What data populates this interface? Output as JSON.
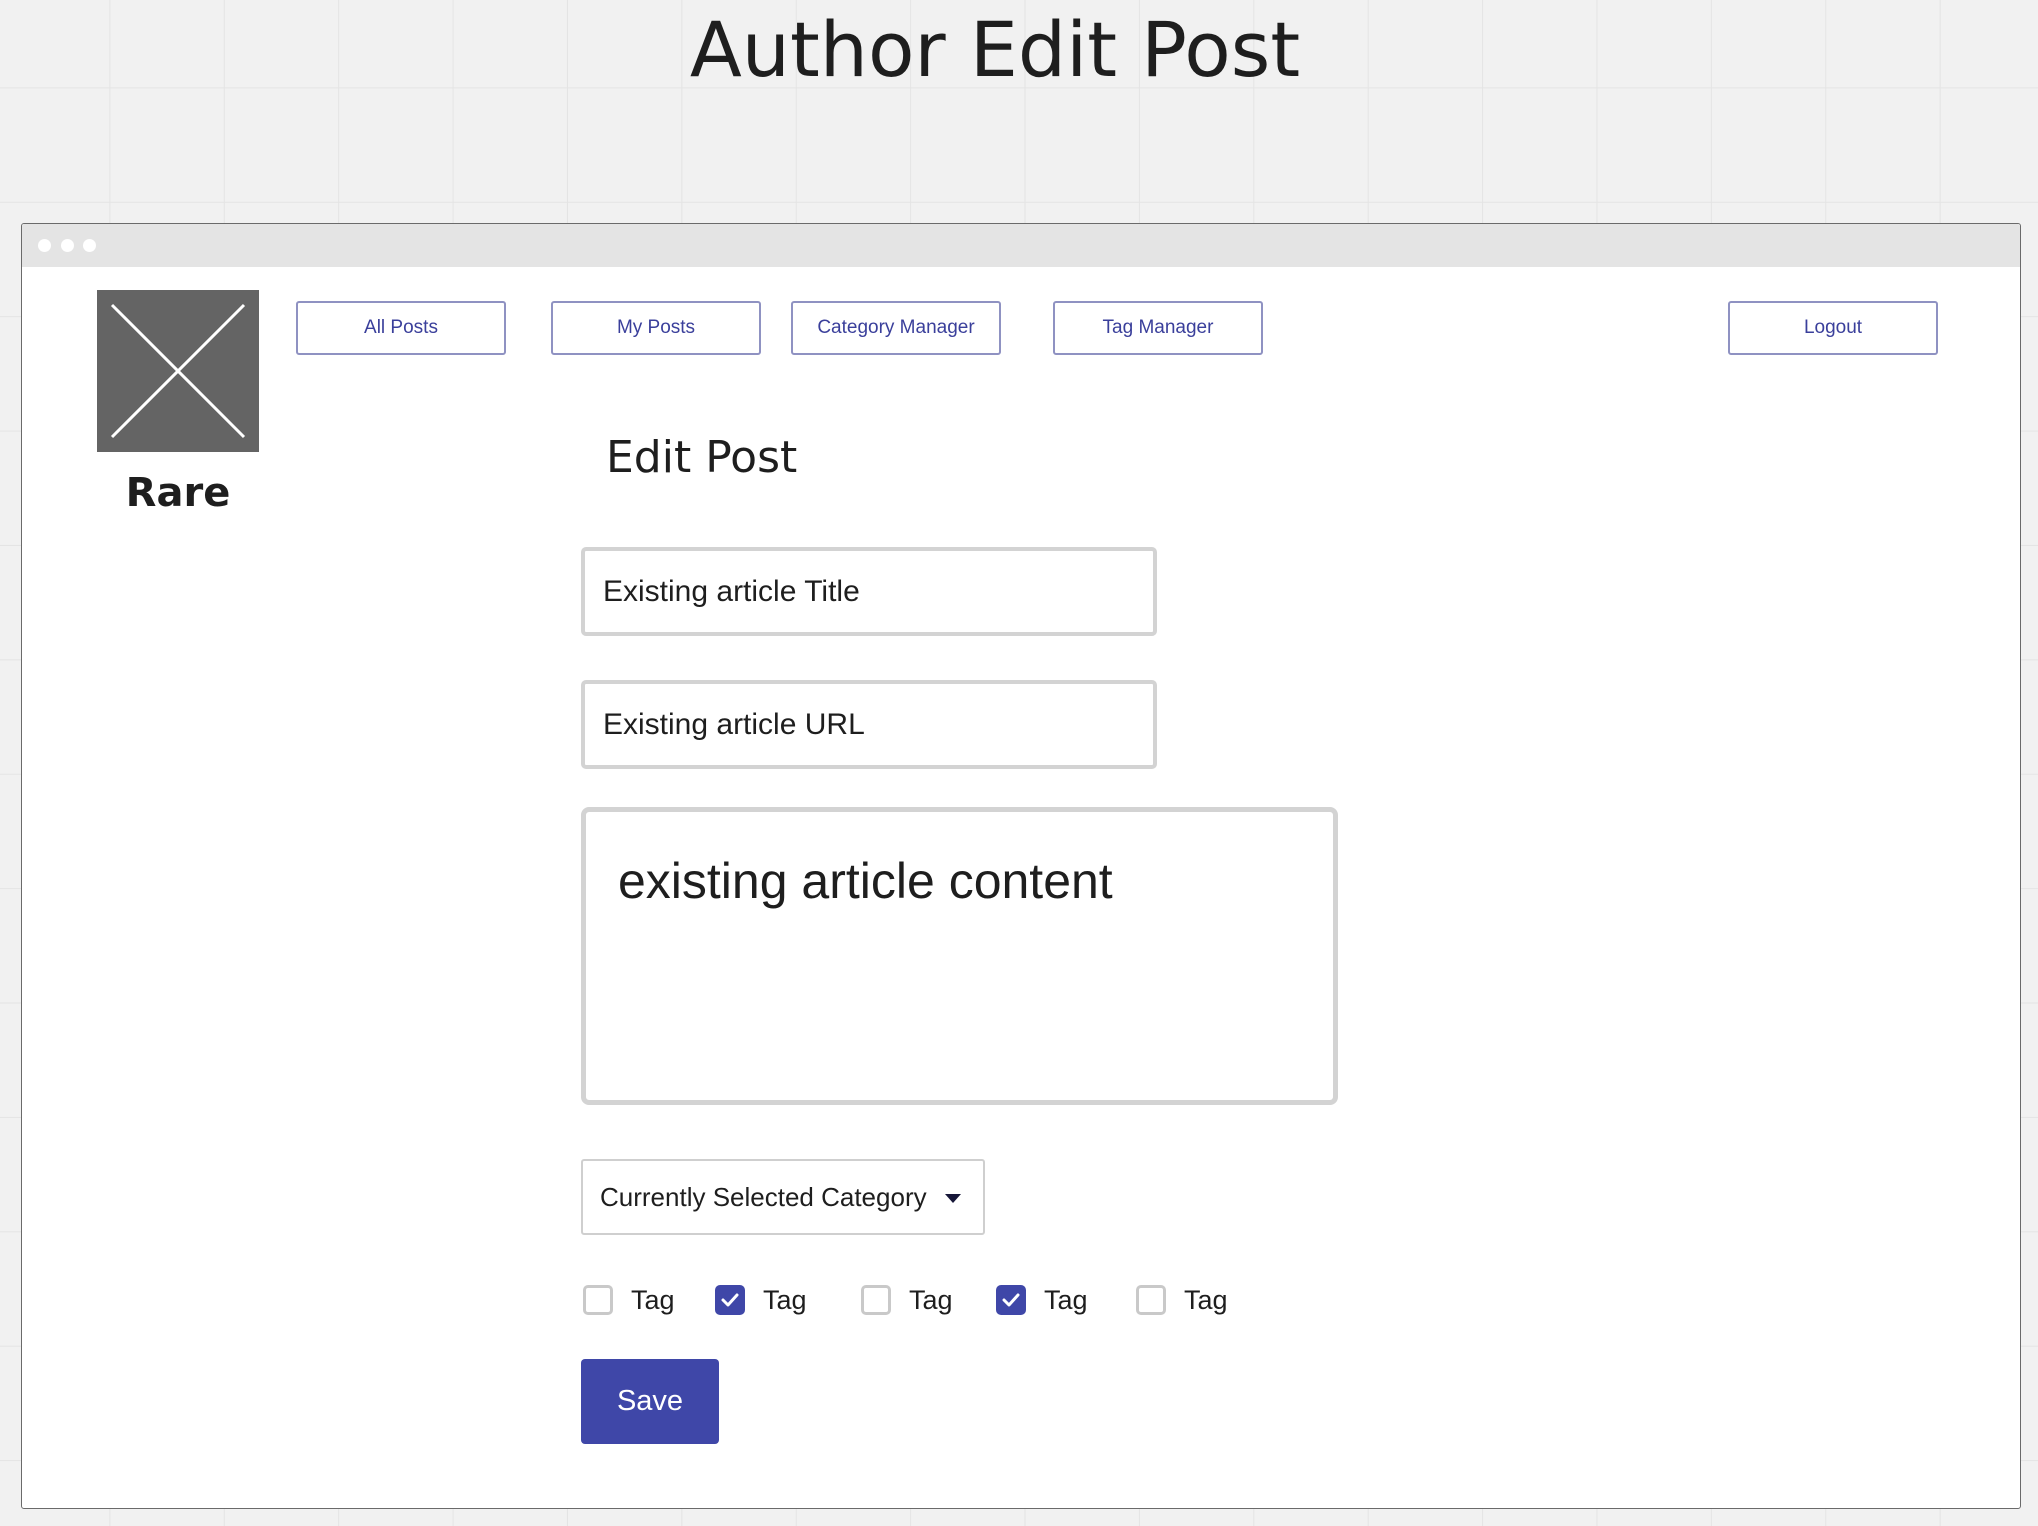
{
  "page": {
    "title": "Author Edit Post"
  },
  "brand": {
    "name": "Rare"
  },
  "nav": {
    "all_posts": "All Posts",
    "my_posts": "My Posts",
    "category_manager": "Category Manager",
    "tag_manager": "Tag Manager",
    "logout": "Logout"
  },
  "form": {
    "heading": "Edit Post",
    "title_value": "Existing article Title",
    "url_value": "Existing article URL",
    "content_value": "existing article content",
    "category_selected": "Currently Selected Category",
    "tags": [
      {
        "label": "Tag",
        "checked": false
      },
      {
        "label": "Tag",
        "checked": true
      },
      {
        "label": "Tag",
        "checked": false
      },
      {
        "label": "Tag",
        "checked": true
      },
      {
        "label": "Tag",
        "checked": false
      }
    ],
    "save_label": "Save"
  },
  "colors": {
    "accent": "#3f47a8",
    "nav_border": "#8f92c2",
    "nav_text": "#3a3f9b",
    "logo_bg": "#646464"
  },
  "icons": {
    "logo": "image-placeholder-icon",
    "select": "caret-down-icon",
    "checkbox": "checkmark-icon"
  }
}
